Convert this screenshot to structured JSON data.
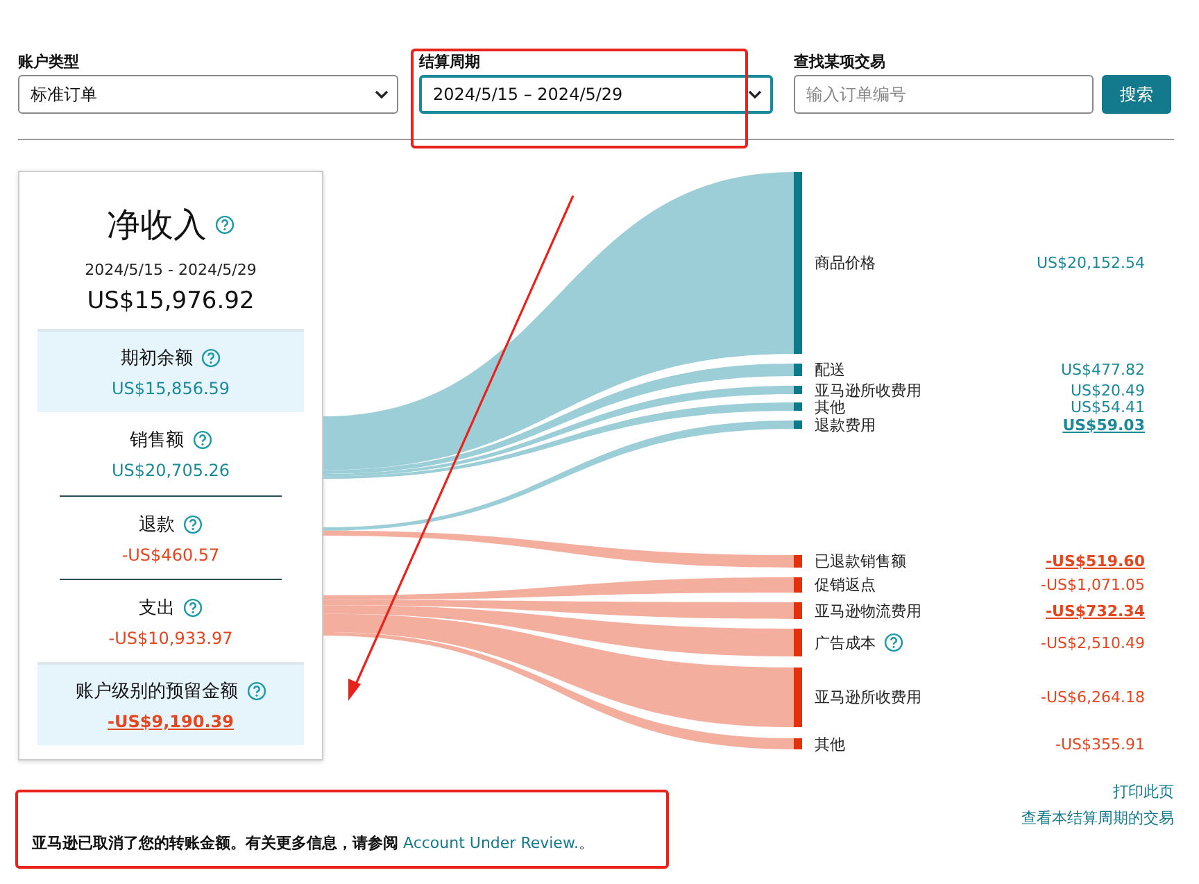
{
  "filters": [
    {
      "kind": "select",
      "label": "账户类型",
      "value": "标准订单"
    },
    {
      "kind": "select",
      "label": "结算周期",
      "value": "2024/5/15 – 2024/5/29"
    },
    {
      "kind": "search",
      "label": "查找某项交易",
      "placeholder": "输入订单编号",
      "button": "搜索"
    }
  ],
  "summary": {
    "title": "净收入",
    "period": "2024/5/15 - 2024/5/29",
    "total": "US$15,976.92",
    "sections": [
      {
        "label": "期初余额",
        "amount": "US$15,856.59",
        "kind": "positive",
        "highlighted": true,
        "link": false
      },
      {
        "label": "销售额",
        "amount": "US$20,705.26",
        "kind": "positive",
        "highlighted": false,
        "link": false
      },
      {
        "label": "退款",
        "amount": "-US$460.57",
        "kind": "negative",
        "highlighted": false,
        "link": false
      },
      {
        "label": "支出",
        "amount": "-US$10,933.97",
        "kind": "negative",
        "highlighted": false,
        "link": false
      },
      {
        "label": "账户级别的预留金额",
        "amount": "-US$9,190.39",
        "kind": "negative",
        "highlighted": true,
        "link": true
      }
    ]
  },
  "breakdown": [
    {
      "label": "商品价格",
      "amount": "US$20,152.54",
      "kind": "credit",
      "link": false,
      "help": false
    },
    {
      "label": "配送",
      "amount": "US$477.82",
      "kind": "credit",
      "link": false,
      "help": false
    },
    {
      "label": "亚马逊所收费用",
      "amount": "US$20.49",
      "kind": "credit",
      "link": false,
      "help": false
    },
    {
      "label": "其他",
      "amount": "US$54.41",
      "kind": "credit",
      "link": false,
      "help": false
    },
    {
      "label": "退款费用",
      "amount": "US$59.03",
      "kind": "credit",
      "link": true,
      "help": false
    },
    {
      "label": "已退款销售额",
      "amount": "-US$519.60",
      "kind": "debit",
      "link": true,
      "help": false
    },
    {
      "label": "促销返点",
      "amount": "-US$1,071.05",
      "kind": "debit",
      "link": false,
      "help": false
    },
    {
      "label": "亚马逊物流费用",
      "amount": "-US$732.34",
      "kind": "debit",
      "link": true,
      "help": false
    },
    {
      "label": "广告成本",
      "amount": "-US$2,510.49",
      "kind": "debit",
      "link": false,
      "help": true
    },
    {
      "label": "亚马逊所收费用",
      "amount": "-US$6,264.18",
      "kind": "debit",
      "link": false,
      "help": false
    },
    {
      "label": "其他",
      "amount": "-US$355.91",
      "kind": "debit",
      "link": false,
      "help": false
    }
  ],
  "links": [
    "打印此页",
    "查看本结算周期的交易"
  ],
  "notice": {
    "text": "**亚马逊已取消了您的转账金额。有关更多信息，请参阅**",
    "link": "Account Under Review.",
    "after": "。"
  }
}
